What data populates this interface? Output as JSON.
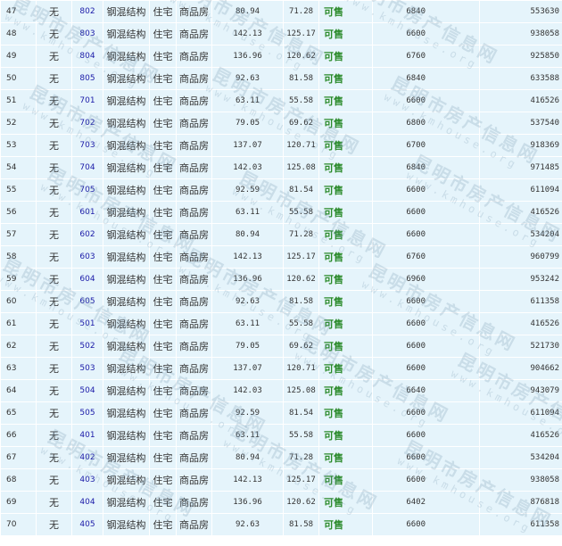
{
  "watermark": {
    "cn": "昆明市房产信息网",
    "en": "www.kmhouse.org"
  },
  "rows": [
    {
      "idx": "47",
      "none": "无",
      "room": "802",
      "struct": "钢混结构",
      "use": "住宅",
      "type": "商品房",
      "area": "80.94",
      "inner": "71.28",
      "status": "可售",
      "price": "6840",
      "total": "553630"
    },
    {
      "idx": "48",
      "none": "无",
      "room": "803",
      "struct": "钢混结构",
      "use": "住宅",
      "type": "商品房",
      "area": "142.13",
      "inner": "125.17",
      "status": "可售",
      "price": "6600",
      "total": "938058"
    },
    {
      "idx": "49",
      "none": "无",
      "room": "804",
      "struct": "钢混结构",
      "use": "住宅",
      "type": "商品房",
      "area": "136.96",
      "inner": "120.62",
      "status": "可售",
      "price": "6760",
      "total": "925850"
    },
    {
      "idx": "50",
      "none": "无",
      "room": "805",
      "struct": "钢混结构",
      "use": "住宅",
      "type": "商品房",
      "area": "92.63",
      "inner": "81.58",
      "status": "可售",
      "price": "6840",
      "total": "633588"
    },
    {
      "idx": "51",
      "none": "无",
      "room": "701",
      "struct": "钢混结构",
      "use": "住宅",
      "type": "商品房",
      "area": "63.11",
      "inner": "55.58",
      "status": "可售",
      "price": "6600",
      "total": "416526"
    },
    {
      "idx": "52",
      "none": "无",
      "room": "702",
      "struct": "钢混结构",
      "use": "住宅",
      "type": "商品房",
      "area": "79.05",
      "inner": "69.62",
      "status": "可售",
      "price": "6800",
      "total": "537540"
    },
    {
      "idx": "53",
      "none": "无",
      "room": "703",
      "struct": "钢混结构",
      "use": "住宅",
      "type": "商品房",
      "area": "137.07",
      "inner": "120.71",
      "status": "可售",
      "price": "6700",
      "total": "918369"
    },
    {
      "idx": "54",
      "none": "无",
      "room": "704",
      "struct": "钢混结构",
      "use": "住宅",
      "type": "商品房",
      "area": "142.03",
      "inner": "125.08",
      "status": "可售",
      "price": "6840",
      "total": "971485"
    },
    {
      "idx": "55",
      "none": "无",
      "room": "705",
      "struct": "钢混结构",
      "use": "住宅",
      "type": "商品房",
      "area": "92.59",
      "inner": "81.54",
      "status": "可售",
      "price": "6600",
      "total": "611094"
    },
    {
      "idx": "56",
      "none": "无",
      "room": "601",
      "struct": "钢混结构",
      "use": "住宅",
      "type": "商品房",
      "area": "63.11",
      "inner": "55.58",
      "status": "可售",
      "price": "6600",
      "total": "416526"
    },
    {
      "idx": "57",
      "none": "无",
      "room": "602",
      "struct": "钢混结构",
      "use": "住宅",
      "type": "商品房",
      "area": "80.94",
      "inner": "71.28",
      "status": "可售",
      "price": "6600",
      "total": "534204"
    },
    {
      "idx": "58",
      "none": "无",
      "room": "603",
      "struct": "钢混结构",
      "use": "住宅",
      "type": "商品房",
      "area": "142.13",
      "inner": "125.17",
      "status": "可售",
      "price": "6760",
      "total": "960799"
    },
    {
      "idx": "59",
      "none": "无",
      "room": "604",
      "struct": "钢混结构",
      "use": "住宅",
      "type": "商品房",
      "area": "136.96",
      "inner": "120.62",
      "status": "可售",
      "price": "6960",
      "total": "953242"
    },
    {
      "idx": "60",
      "none": "无",
      "room": "605",
      "struct": "钢混结构",
      "use": "住宅",
      "type": "商品房",
      "area": "92.63",
      "inner": "81.58",
      "status": "可售",
      "price": "6600",
      "total": "611358"
    },
    {
      "idx": "61",
      "none": "无",
      "room": "501",
      "struct": "钢混结构",
      "use": "住宅",
      "type": "商品房",
      "area": "63.11",
      "inner": "55.58",
      "status": "可售",
      "price": "6600",
      "total": "416526"
    },
    {
      "idx": "62",
      "none": "无",
      "room": "502",
      "struct": "钢混结构",
      "use": "住宅",
      "type": "商品房",
      "area": "79.05",
      "inner": "69.62",
      "status": "可售",
      "price": "6600",
      "total": "521730"
    },
    {
      "idx": "63",
      "none": "无",
      "room": "503",
      "struct": "钢混结构",
      "use": "住宅",
      "type": "商品房",
      "area": "137.07",
      "inner": "120.71",
      "status": "可售",
      "price": "6600",
      "total": "904662"
    },
    {
      "idx": "64",
      "none": "无",
      "room": "504",
      "struct": "钢混结构",
      "use": "住宅",
      "type": "商品房",
      "area": "142.03",
      "inner": "125.08",
      "status": "可售",
      "price": "6640",
      "total": "943079"
    },
    {
      "idx": "65",
      "none": "无",
      "room": "505",
      "struct": "钢混结构",
      "use": "住宅",
      "type": "商品房",
      "area": "92.59",
      "inner": "81.54",
      "status": "可售",
      "price": "6600",
      "total": "611094"
    },
    {
      "idx": "66",
      "none": "无",
      "room": "401",
      "struct": "钢混结构",
      "use": "住宅",
      "type": "商品房",
      "area": "63.11",
      "inner": "55.58",
      "status": "可售",
      "price": "6600",
      "total": "416526"
    },
    {
      "idx": "67",
      "none": "无",
      "room": "402",
      "struct": "钢混结构",
      "use": "住宅",
      "type": "商品房",
      "area": "80.94",
      "inner": "71.28",
      "status": "可售",
      "price": "6600",
      "total": "534204"
    },
    {
      "idx": "68",
      "none": "无",
      "room": "403",
      "struct": "钢混结构",
      "use": "住宅",
      "type": "商品房",
      "area": "142.13",
      "inner": "125.17",
      "status": "可售",
      "price": "6600",
      "total": "938058"
    },
    {
      "idx": "69",
      "none": "无",
      "room": "404",
      "struct": "钢混结构",
      "use": "住宅",
      "type": "商品房",
      "area": "136.96",
      "inner": "120.62",
      "status": "可售",
      "price": "6402",
      "total": "876818"
    },
    {
      "idx": "70",
      "none": "无",
      "room": "405",
      "struct": "钢混结构",
      "use": "住宅",
      "type": "商品房",
      "area": "92.63",
      "inner": "81.58",
      "status": "可售",
      "price": "6600",
      "total": "611358"
    }
  ]
}
